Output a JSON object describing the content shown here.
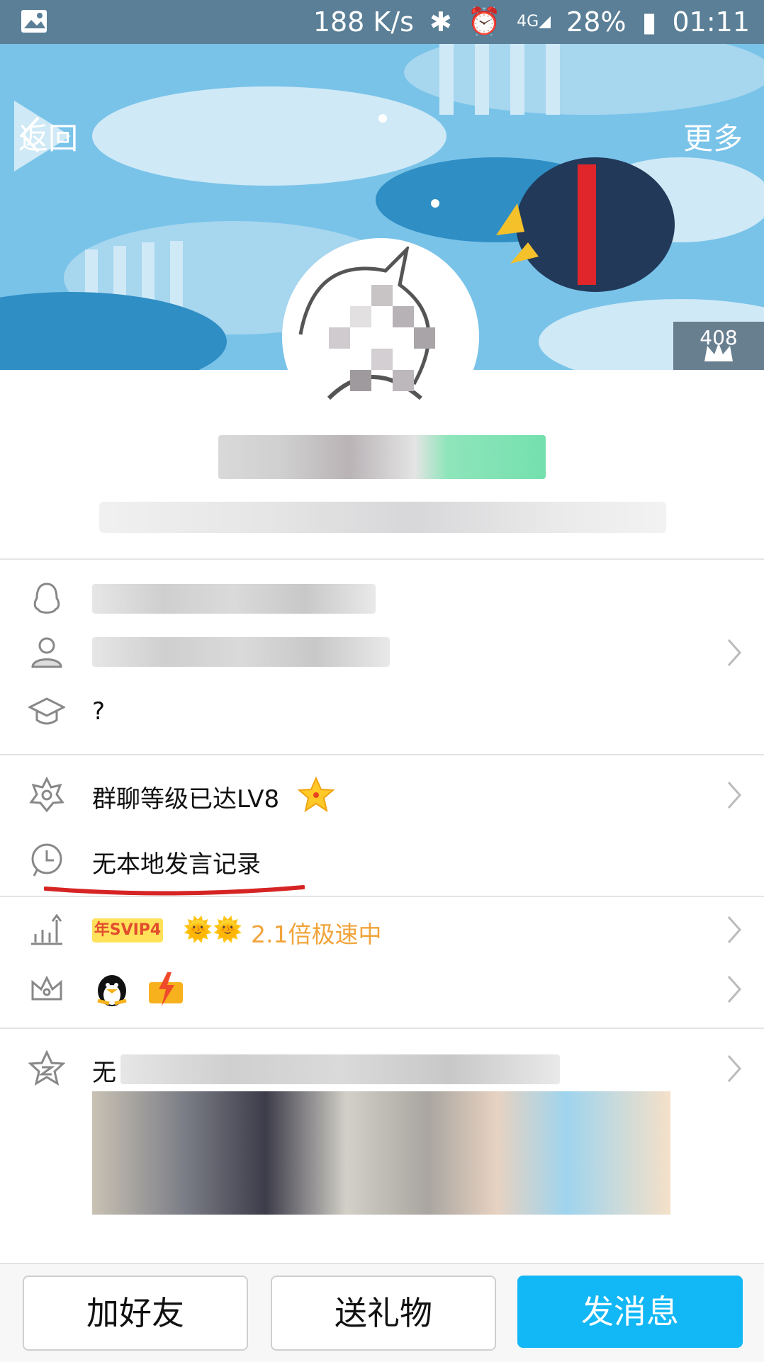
{
  "status_bar": {
    "speed": "188 K/s",
    "network": "4G",
    "battery": "28%",
    "time": "01:11"
  },
  "header": {
    "back_label": "返回",
    "more_label": "更多",
    "crown_count": "408"
  },
  "profile_rows": {
    "school": "?"
  },
  "group_rows": {
    "group_level": "群聊等级已达LV8",
    "speech_record": "无本地发言记录"
  },
  "vip_rows": {
    "vip_badge": "年SVIP4",
    "speed_text": "2.1倍极速中"
  },
  "space_row": {
    "title_prefix": "无"
  },
  "actions": {
    "add_friend": "加好友",
    "send_gift": "送礼物",
    "send_message": "发消息"
  },
  "colors": {
    "primary": "#12b7f5",
    "accent_orange": "#f1a43b",
    "banner": "#6fbde6",
    "underline_red": "#d62424"
  }
}
